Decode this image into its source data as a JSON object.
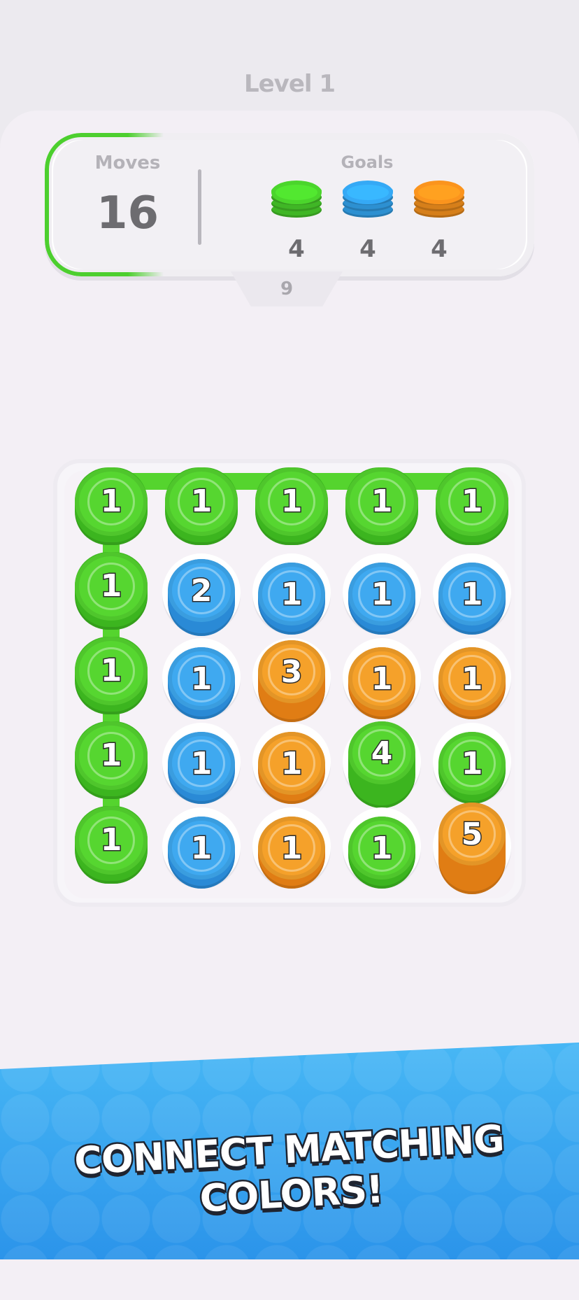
{
  "header": {
    "level": "Level 1"
  },
  "hud": {
    "moves_label": "Moves",
    "moves_value": "16",
    "goals_label": "Goals",
    "goals": [
      {
        "color_name": "green",
        "color": "#49cf2b",
        "count": "4"
      },
      {
        "color_name": "blue",
        "color": "#33a4ee",
        "count": "4"
      },
      {
        "color_name": "orange",
        "color": "#f3901d",
        "count": "4"
      }
    ],
    "tab_value": "9"
  },
  "colors": {
    "green": "#56d630",
    "green_dark": "#3cb51f",
    "blue": "#3fa9f0",
    "blue_dark": "#2a8ad6",
    "orange": "#f5a12a",
    "orange_dark": "#e07d14"
  },
  "board": {
    "rows": [
      [
        {
          "color": "green",
          "value": "1",
          "height": 1,
          "selected": true
        },
        {
          "color": "green",
          "value": "1",
          "height": 1,
          "selected": true
        },
        {
          "color": "green",
          "value": "1",
          "height": 1,
          "selected": true
        },
        {
          "color": "green",
          "value": "1",
          "height": 1,
          "selected": true
        },
        {
          "color": "green",
          "value": "1",
          "height": 1,
          "selected": true
        }
      ],
      [
        {
          "color": "green",
          "value": "1",
          "height": 1,
          "selected": true
        },
        {
          "color": "blue",
          "value": "2",
          "height": 2,
          "selected": false
        },
        {
          "color": "blue",
          "value": "1",
          "height": 1,
          "selected": false
        },
        {
          "color": "blue",
          "value": "1",
          "height": 1,
          "selected": false
        },
        {
          "color": "blue",
          "value": "1",
          "height": 1,
          "selected": false
        }
      ],
      [
        {
          "color": "green",
          "value": "1",
          "height": 1,
          "selected": true
        },
        {
          "color": "blue",
          "value": "1",
          "height": 1,
          "selected": false
        },
        {
          "color": "orange",
          "value": "3",
          "height": 3,
          "selected": false
        },
        {
          "color": "orange",
          "value": "1",
          "height": 1,
          "selected": false
        },
        {
          "color": "orange",
          "value": "1",
          "height": 1,
          "selected": false
        }
      ],
      [
        {
          "color": "green",
          "value": "1",
          "height": 1,
          "selected": true
        },
        {
          "color": "blue",
          "value": "1",
          "height": 1,
          "selected": false
        },
        {
          "color": "orange",
          "value": "1",
          "height": 1,
          "selected": false
        },
        {
          "color": "green",
          "value": "4",
          "height": 4,
          "selected": false
        },
        {
          "color": "green",
          "value": "1",
          "height": 1,
          "selected": false
        }
      ],
      [
        {
          "color": "green",
          "value": "1",
          "height": 1,
          "selected": true
        },
        {
          "color": "blue",
          "value": "1",
          "height": 1,
          "selected": false
        },
        {
          "color": "orange",
          "value": "1",
          "height": 1,
          "selected": false
        },
        {
          "color": "green",
          "value": "1",
          "height": 1,
          "selected": false
        },
        {
          "color": "orange",
          "value": "5",
          "height": 5,
          "selected": false
        }
      ]
    ],
    "path": [
      [
        0,
        4
      ],
      [
        0,
        3
      ],
      [
        0,
        2
      ],
      [
        0,
        1
      ],
      [
        0,
        0
      ],
      [
        1,
        0
      ],
      [
        2,
        0
      ],
      [
        3,
        0
      ],
      [
        4,
        0
      ]
    ]
  },
  "banner": {
    "text": "CONNECT MATCHING COLORS!"
  }
}
